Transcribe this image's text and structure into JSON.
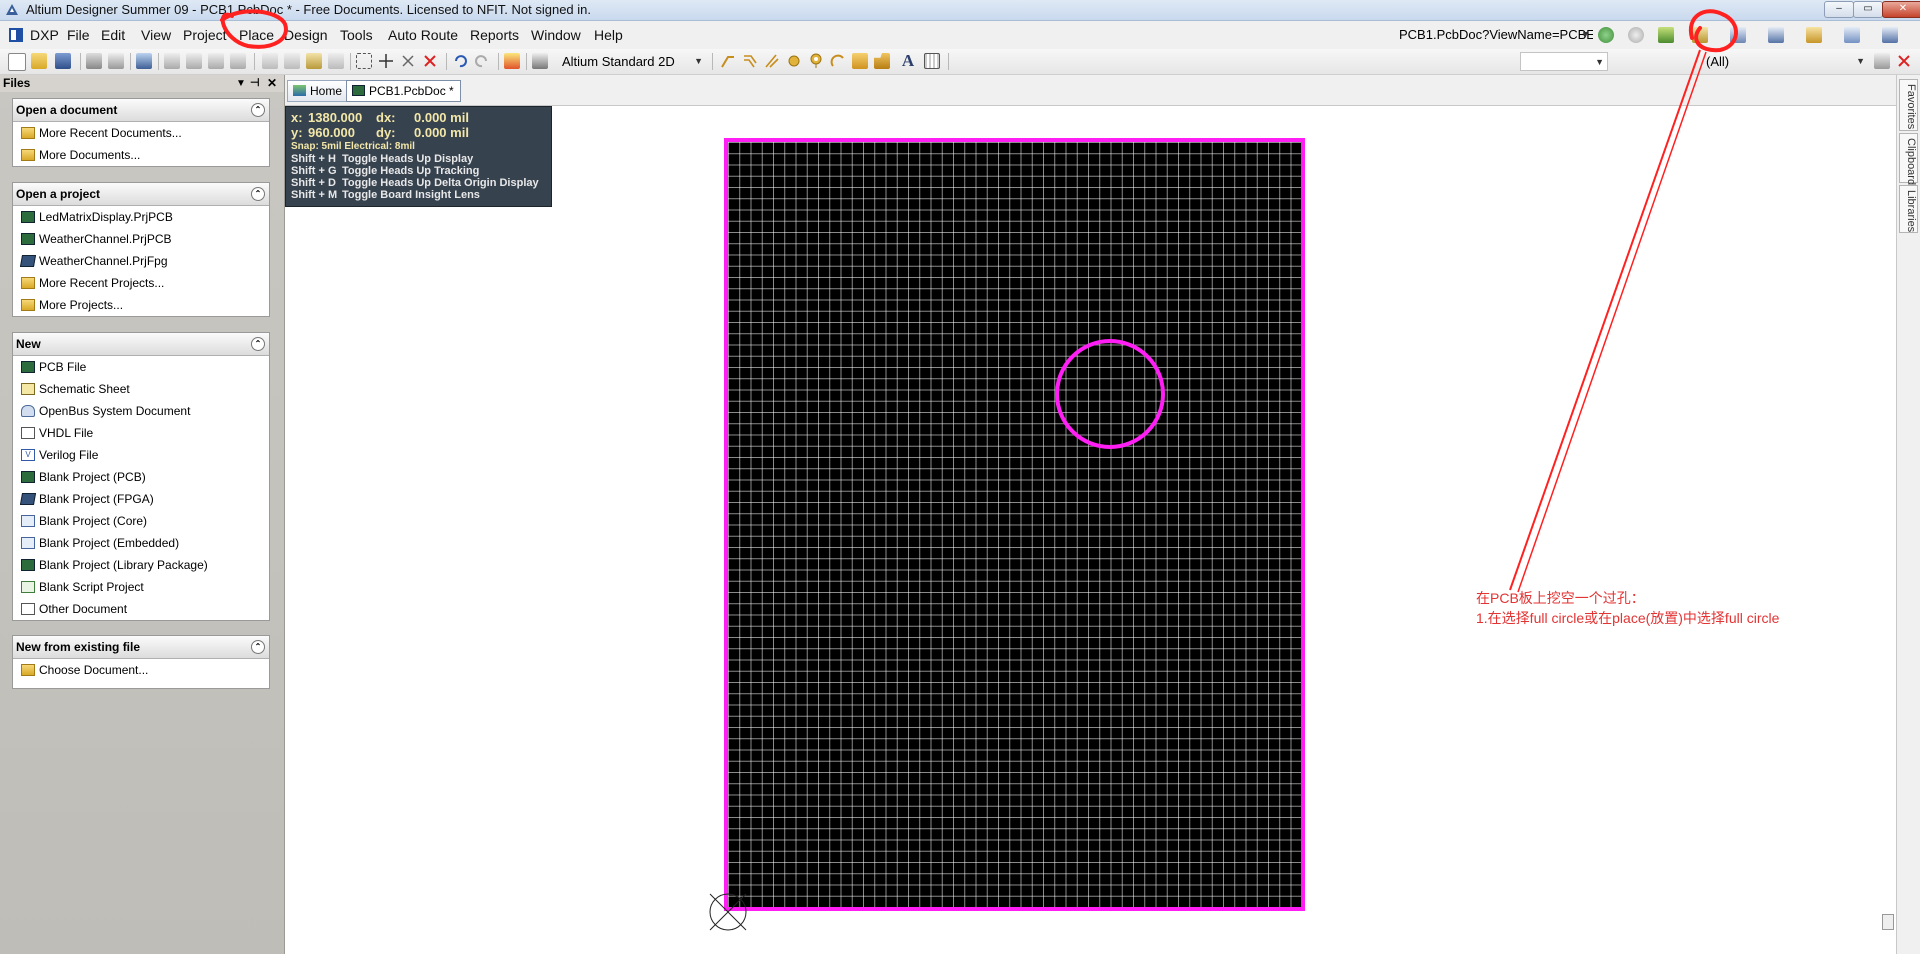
{
  "window": {
    "title": "Altium Designer Summer 09 - PCB1.PcbDoc * - Free Documents. Licensed to NFIT. Not signed in.",
    "min_label": "–",
    "max_label": "▭",
    "close_label": "✕"
  },
  "menu": {
    "items": [
      {
        "label": "DXP"
      },
      {
        "label": "File"
      },
      {
        "label": "Edit"
      },
      {
        "label": "View"
      },
      {
        "label": "Project"
      },
      {
        "label": "Place"
      },
      {
        "label": "Design"
      },
      {
        "label": "Tools"
      },
      {
        "label": "Auto Route"
      },
      {
        "label": "Reports"
      },
      {
        "label": "Window"
      },
      {
        "label": "Help"
      }
    ],
    "address": "PCB1.PcbDoc?ViewName=PCBE"
  },
  "toolbar": {
    "view_mode": "Altium Standard 2D",
    "filter": "(All)"
  },
  "panel": {
    "title": "Files",
    "collapse_glyph": "⌃",
    "sections": [
      {
        "title": "Open a document",
        "items": [
          {
            "label": "More Recent Documents...",
            "icon": "folder-icon"
          },
          {
            "label": "More Documents...",
            "icon": "open-folder-icon"
          }
        ]
      },
      {
        "title": "Open a project",
        "items": [
          {
            "label": "LedMatrixDisplay.PrjPCB",
            "icon": "pcb-project-icon"
          },
          {
            "label": "WeatherChannel.PrjPCB",
            "icon": "pcb-project-icon"
          },
          {
            "label": "WeatherChannel.PrjFpg",
            "icon": "fpga-project-icon"
          },
          {
            "label": "More Recent Projects...",
            "icon": "folder-icon"
          },
          {
            "label": "More Projects...",
            "icon": "open-folder-icon"
          }
        ]
      },
      {
        "title": "New",
        "items": [
          {
            "label": "PCB File",
            "icon": "pcb-file-icon"
          },
          {
            "label": "Schematic Sheet",
            "icon": "schematic-icon"
          },
          {
            "label": "OpenBus System Document",
            "icon": "openbus-icon"
          },
          {
            "label": "VHDL File",
            "icon": "vhdl-icon"
          },
          {
            "label": "Verilog File",
            "icon": "verilog-icon"
          },
          {
            "label": "Blank Project (PCB)",
            "icon": "pcb-project-icon"
          },
          {
            "label": "Blank Project (FPGA)",
            "icon": "fpga-project-icon"
          },
          {
            "label": "Blank Project (Core)",
            "icon": "core-project-icon"
          },
          {
            "label": "Blank Project (Embedded)",
            "icon": "embedded-project-icon"
          },
          {
            "label": "Blank Project (Library Package)",
            "icon": "library-project-icon"
          },
          {
            "label": "Blank Script Project",
            "icon": "script-project-icon"
          },
          {
            "label": "Other Document",
            "icon": "document-icon"
          }
        ]
      },
      {
        "title": "New from existing file",
        "items": [
          {
            "label": "Choose Document...",
            "icon": "open-folder-icon"
          }
        ]
      }
    ]
  },
  "tabs": [
    {
      "label": "Home",
      "icon": "home-icon"
    },
    {
      "label": "PCB1.PcbDoc *",
      "icon": "pcb-file-icon"
    }
  ],
  "right_panels": [
    "Favorites",
    "Clipboard",
    "Libraries"
  ],
  "hud": {
    "x_label": "x:",
    "x_value": "1380.000",
    "dx_label": "dx:",
    "dx_value": "0.000 mil",
    "y_label": "y:",
    "y_value": "960.000",
    "dy_label": "dy:",
    "dy_value": "0.000 mil",
    "snap": "Snap: 5mil Electrical: 8mil",
    "shortcuts": [
      {
        "key": "Shift + H",
        "action": "Toggle Heads Up Display"
      },
      {
        "key": "Shift + G",
        "action": "Toggle Heads Up Tracking"
      },
      {
        "key": "Shift + D",
        "action": "Toggle Heads Up Delta Origin Display"
      },
      {
        "key": "Shift + M",
        "action": "Toggle Board Insight Lens"
      }
    ]
  },
  "annotation": {
    "line1": "在PCB板上挖空一个过孔：",
    "line2": "1.在选择full circle或在place(放置)中选择full circle",
    "color": "#e33333"
  },
  "colors": {
    "board_outline": "#ff1ff5",
    "board_fill": "#000000",
    "annotation_red": "#ff2a2a"
  }
}
